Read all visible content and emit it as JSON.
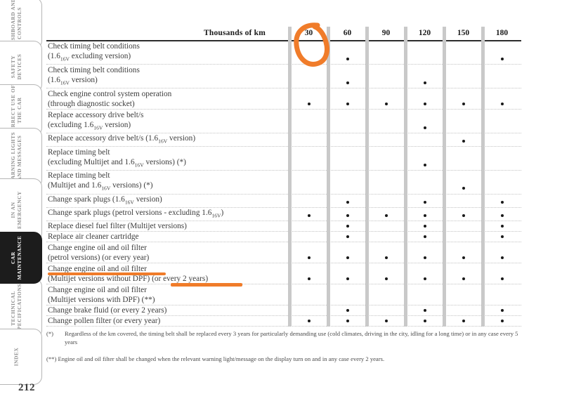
{
  "document": {
    "page_number": "212"
  },
  "sidebar": {
    "tabs": [
      {
        "label": "DASHBOARD AND CONTROLS",
        "active": false
      },
      {
        "label": "SAFETY DEVICES",
        "active": false
      },
      {
        "label": "CORRECT USE OF THE CAR",
        "active": false
      },
      {
        "label": "WARNING LIGHTS AND MESSAGES",
        "active": false
      },
      {
        "label": "IN AN EMERGENCY",
        "active": false
      },
      {
        "label": "CAR MAINTENANCE",
        "active": true
      },
      {
        "label": "TECHNICAL SPECIFICATIONS",
        "active": false
      },
      {
        "label": "INDEX",
        "active": false
      }
    ]
  },
  "table": {
    "header_label": "Thousands of km",
    "columns": [
      "30",
      "60",
      "90",
      "120",
      "150",
      "180"
    ],
    "rows": [
      {
        "line1": "Check timing belt conditions",
        "line2_pre": "(1.6",
        "line2_sub": "16V",
        "line2_post": " excluding version)",
        "dots": [
          false,
          true,
          false,
          false,
          false,
          true
        ]
      },
      {
        "line1": "Check timing belt conditions",
        "line2_pre": "(1.6",
        "line2_sub": "16V",
        "line2_post": " version)",
        "dots": [
          false,
          true,
          false,
          true,
          false,
          false
        ]
      },
      {
        "line1": "Check engine control system operation",
        "line2_pre": "(through diagnostic socket)",
        "line2_sub": "",
        "line2_post": "",
        "dots": [
          true,
          true,
          true,
          true,
          true,
          true
        ]
      },
      {
        "line1": "Replace accessory drive belt/s",
        "line2_pre": "(excluding 1.6",
        "line2_sub": "16V",
        "line2_post": " version)",
        "dots": [
          false,
          false,
          false,
          true,
          false,
          false
        ]
      },
      {
        "line1": "",
        "line2_pre": "Replace accessory drive belt/s (1.6",
        "line2_sub": "16V",
        "line2_post": " version)",
        "dots": [
          false,
          false,
          false,
          false,
          true,
          false
        ]
      },
      {
        "line1": "Replace timing belt",
        "line2_pre": "(excluding Multijet and 1.6",
        "line2_sub": "16V",
        "line2_post": " versions) (*)",
        "dots": [
          false,
          false,
          false,
          true,
          false,
          false
        ]
      },
      {
        "line1": "Replace timing belt",
        "line2_pre": "(Multijet and 1.6",
        "line2_sub": "16V",
        "line2_post": " versions) (*)",
        "dots": [
          false,
          false,
          false,
          false,
          true,
          false
        ]
      },
      {
        "line1": "",
        "line2_pre": "Change spark plugs (1.6",
        "line2_sub": "16V",
        "line2_post": " version)",
        "dots": [
          false,
          true,
          false,
          true,
          false,
          true
        ]
      },
      {
        "line1": "",
        "line2_pre": "Change spark plugs (petrol versions - excluding 1.6",
        "line2_sub": "16V",
        "line2_post": ")",
        "dots": [
          true,
          true,
          true,
          true,
          true,
          true
        ]
      },
      {
        "line1": "",
        "line2_pre": "Replace diesel fuel filter (Multijet versions)",
        "line2_sub": "",
        "line2_post": "",
        "dots": [
          false,
          true,
          false,
          true,
          false,
          true
        ]
      },
      {
        "line1": "",
        "line2_pre": "Replace air cleaner cartridge",
        "line2_sub": "",
        "line2_post": "",
        "dots": [
          false,
          true,
          false,
          true,
          false,
          true
        ]
      },
      {
        "line1": "Change engine oil and oil filter",
        "line2_pre": "(petrol versions) (or every year)",
        "line2_sub": "",
        "line2_post": "",
        "dots": [
          true,
          true,
          true,
          true,
          true,
          true
        ]
      },
      {
        "line1": "Change engine oil and oil filter",
        "line2_pre": "(Multijet versions without DPF) (or every 2 years)",
        "line2_sub": "",
        "line2_post": "",
        "dots": [
          true,
          true,
          true,
          true,
          true,
          true
        ]
      },
      {
        "line1": "Change engine oil and oil filter",
        "line2_pre": "(Multijet versions with DPF) (**)",
        "line2_sub": "",
        "line2_post": "",
        "dots": [
          false,
          false,
          false,
          false,
          false,
          false
        ]
      },
      {
        "line1": "",
        "line2_pre": "Change brake fluid (or every 2 years)",
        "line2_sub": "",
        "line2_post": "",
        "dots": [
          false,
          true,
          false,
          true,
          false,
          true
        ]
      },
      {
        "line1": "",
        "line2_pre": "Change pollen filter (or every year)",
        "line2_sub": "",
        "line2_post": "",
        "dots": [
          true,
          true,
          true,
          true,
          true,
          true
        ]
      }
    ]
  },
  "footnotes": {
    "fn1_mark": "(*)",
    "fn1_text": "Regardless of the km covered, the timing belt shall be replaced every 3 years for particularly demanding use (cold climates, driving in the city, idling for a long time) or in any case every 5 years",
    "fn2_text": "(**) Engine oil and oil filter shall be changed when the relevant warning light/message on the display turn on and in any case every 2 years."
  },
  "annotations": {
    "color": "#f07c2a",
    "circle_target": "30",
    "underline_1_target": "Change engine oil and oil filter",
    "underline_2_target": "(or every 2 years)"
  }
}
